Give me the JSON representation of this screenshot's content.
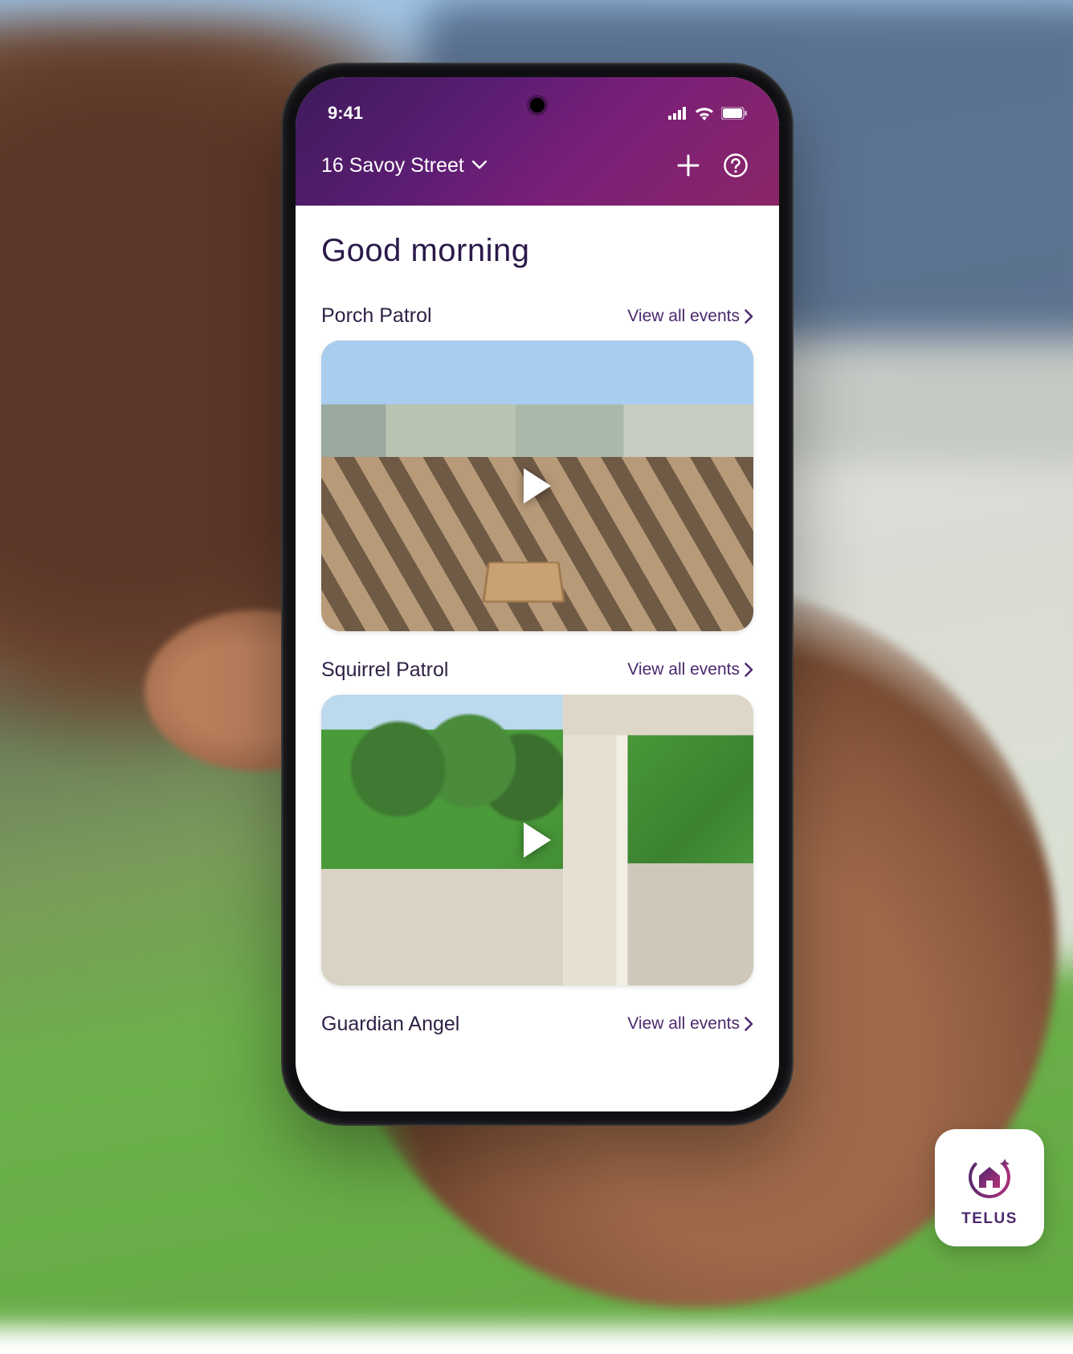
{
  "status": {
    "time": "9:41"
  },
  "header": {
    "location": "16 Savoy Street"
  },
  "greeting": "Good morning",
  "view_all_label": "View all events",
  "cameras": [
    {
      "title": "Porch Patrol"
    },
    {
      "title": "Squirrel Patrol"
    },
    {
      "title": "Guardian Angel"
    }
  ],
  "brand": {
    "name": "TELUS"
  }
}
